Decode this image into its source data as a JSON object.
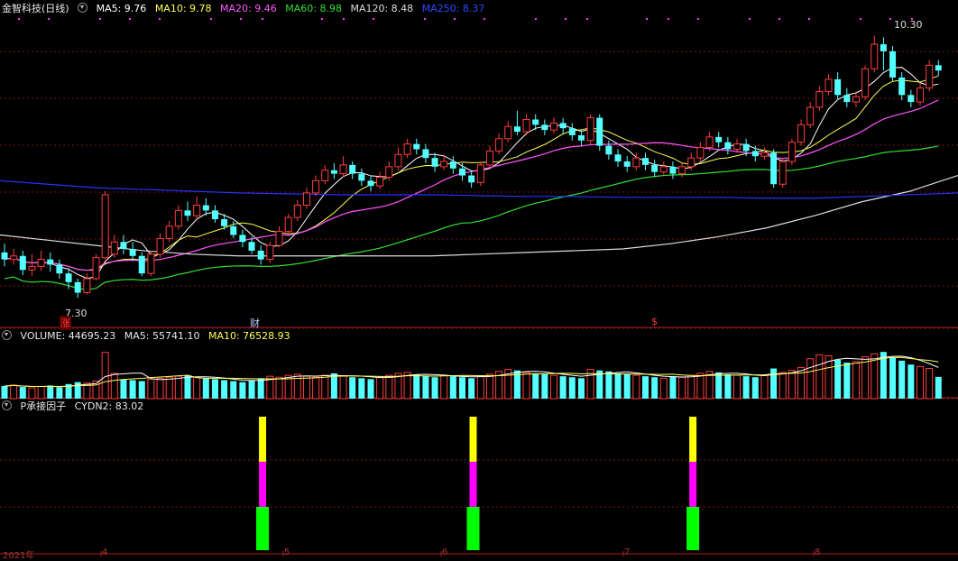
{
  "header_main": {
    "title": "金智科技(日线)",
    "ma5": "MA5: 9.76",
    "ma10": "MA10: 9.78",
    "ma20": "MA20: 9.46",
    "ma60": "MA60: 8.98",
    "ma120": "MA120: 8.48",
    "ma250": "MA250: 8.37"
  },
  "header_volume": {
    "volume": "VOLUME: 44695.23",
    "ma5": "MA5: 55741.10",
    "ma10": "MA10: 76528.93"
  },
  "header_indicator": {
    "name": "P承接因子",
    "value": "CYDN2: 83.02"
  },
  "annotations": {
    "high": "10.30",
    "low": "7.30",
    "tag_zhang": "涨",
    "tag_cai": "财",
    "tag_dollar": "$"
  },
  "bottom_axis": {
    "year": "2021年",
    "marks": [
      "4",
      "5",
      "6",
      "7",
      "8"
    ]
  },
  "colors": {
    "up": "#ff3c3c",
    "down": "#54ffff",
    "ma5": "#ffffff",
    "ma10": "#ffff55",
    "ma20": "#ff55ff",
    "ma60": "#33dd33",
    "ma120": "#dddddd",
    "ma250": "#2233ff",
    "grid": "#7a1515",
    "cyd_low": "#00ff00",
    "cyd_mid": "#ff00ff",
    "cyd_high": "#ffff00"
  },
  "chart_data": {
    "type": "candlestick",
    "price_range": [
      7.2,
      10.5
    ],
    "candles": [
      [
        7.82,
        7.74,
        7.92,
        7.66
      ],
      [
        7.74,
        7.78,
        7.86,
        7.68
      ],
      [
        7.78,
        7.62,
        7.84,
        7.56
      ],
      [
        7.62,
        7.66,
        7.8,
        7.55
      ],
      [
        7.66,
        7.74,
        7.84,
        7.61
      ],
      [
        7.74,
        7.68,
        7.82,
        7.6
      ],
      [
        7.68,
        7.58,
        7.74,
        7.52
      ],
      [
        7.58,
        7.48,
        7.64,
        7.4
      ],
      [
        7.48,
        7.36,
        7.52,
        7.3
      ],
      [
        7.36,
        7.52,
        7.58,
        7.34
      ],
      [
        7.52,
        7.76,
        7.8,
        7.5
      ],
      [
        7.76,
        8.48,
        8.52,
        7.74
      ],
      [
        7.8,
        7.94,
        8.02,
        7.76
      ],
      [
        7.94,
        7.86,
        8.02,
        7.8
      ],
      [
        7.86,
        7.78,
        7.94,
        7.72
      ],
      [
        7.78,
        7.58,
        7.82,
        7.55
      ],
      [
        7.58,
        7.8,
        7.84,
        7.55
      ],
      [
        7.8,
        7.98,
        8.04,
        7.76
      ],
      [
        7.98,
        8.12,
        8.18,
        7.94
      ],
      [
        8.12,
        8.3,
        8.36,
        8.08
      ],
      [
        8.3,
        8.24,
        8.4,
        8.18
      ],
      [
        8.24,
        8.36,
        8.46,
        8.2
      ],
      [
        8.36,
        8.3,
        8.44,
        8.24
      ],
      [
        8.3,
        8.2,
        8.36,
        8.16
      ],
      [
        8.2,
        8.12,
        8.26,
        8.08
      ],
      [
        8.12,
        8.02,
        8.18,
        7.98
      ],
      [
        8.02,
        7.94,
        8.08,
        7.88
      ],
      [
        7.94,
        7.84,
        8.0,
        7.8
      ],
      [
        7.84,
        7.74,
        7.9,
        7.68
      ],
      [
        7.74,
        7.9,
        7.94,
        7.7
      ],
      [
        7.9,
        8.06,
        8.12,
        7.88
      ],
      [
        8.06,
        8.22,
        8.26,
        8.02
      ],
      [
        8.22,
        8.36,
        8.42,
        8.18
      ],
      [
        8.36,
        8.5,
        8.56,
        8.32
      ],
      [
        8.5,
        8.64,
        8.7,
        8.46
      ],
      [
        8.64,
        8.76,
        8.82,
        8.6
      ],
      [
        8.76,
        8.72,
        8.84,
        8.66
      ],
      [
        8.72,
        8.82,
        8.92,
        8.68
      ],
      [
        8.82,
        8.72,
        8.86,
        8.66
      ],
      [
        8.72,
        8.64,
        8.78,
        8.58
      ],
      [
        8.64,
        8.58,
        8.7,
        8.52
      ],
      [
        8.58,
        8.68,
        8.74,
        8.54
      ],
      [
        8.68,
        8.8,
        8.86,
        8.64
      ],
      [
        8.8,
        8.94,
        9.02,
        8.76
      ],
      [
        8.94,
        9.06,
        9.12,
        8.9
      ],
      [
        9.06,
        9.0,
        9.12,
        8.94
      ],
      [
        9.0,
        8.9,
        9.06,
        8.84
      ],
      [
        8.9,
        8.8,
        8.96,
        8.74
      ],
      [
        8.8,
        8.86,
        8.94,
        8.76
      ],
      [
        8.86,
        8.78,
        8.92,
        8.72
      ],
      [
        8.78,
        8.7,
        8.84,
        8.64
      ],
      [
        8.7,
        8.62,
        8.76,
        8.56
      ],
      [
        8.62,
        8.82,
        8.86,
        8.58
      ],
      [
        8.82,
        8.98,
        9.04,
        8.78
      ],
      [
        8.98,
        9.12,
        9.18,
        8.94
      ],
      [
        9.12,
        9.26,
        9.32,
        9.08
      ],
      [
        9.26,
        9.2,
        9.44,
        9.16
      ],
      [
        9.2,
        9.34,
        9.4,
        9.16
      ],
      [
        9.34,
        9.28,
        9.4,
        9.22
      ],
      [
        9.28,
        9.22,
        9.34,
        9.16
      ],
      [
        9.22,
        9.3,
        9.36,
        9.18
      ],
      [
        9.3,
        9.24,
        9.36,
        9.18
      ],
      [
        9.24,
        9.16,
        9.3,
        9.1
      ],
      [
        9.16,
        9.1,
        9.22,
        9.04
      ],
      [
        9.1,
        9.36,
        9.4,
        9.06
      ],
      [
        9.36,
        9.04,
        9.4,
        8.98
      ],
      [
        9.04,
        8.94,
        9.1,
        8.88
      ],
      [
        8.94,
        8.86,
        9.0,
        8.8
      ],
      [
        8.86,
        8.8,
        8.92,
        8.74
      ],
      [
        8.8,
        8.9,
        8.96,
        8.76
      ],
      [
        8.9,
        8.82,
        8.96,
        8.76
      ],
      [
        8.82,
        8.74,
        8.88,
        8.68
      ],
      [
        8.74,
        8.8,
        8.86,
        8.7
      ],
      [
        8.8,
        8.72,
        8.86,
        8.66
      ],
      [
        8.72,
        8.8,
        8.84,
        8.68
      ],
      [
        8.8,
        8.9,
        8.96,
        8.76
      ],
      [
        8.9,
        9.02,
        9.08,
        8.86
      ],
      [
        9.02,
        9.14,
        9.2,
        8.98
      ],
      [
        9.14,
        9.08,
        9.2,
        9.02
      ],
      [
        9.08,
        9.0,
        9.14,
        8.94
      ],
      [
        9.0,
        9.06,
        9.12,
        8.96
      ],
      [
        9.06,
        8.98,
        9.12,
        8.92
      ],
      [
        8.98,
        8.92,
        9.04,
        8.86
      ],
      [
        8.92,
        8.96,
        9.02,
        8.88
      ],
      [
        8.96,
        8.6,
        9.0,
        8.56
      ],
      [
        8.6,
        8.86,
        8.9,
        8.56
      ],
      [
        8.86,
        9.08,
        9.12,
        8.82
      ],
      [
        9.08,
        9.28,
        9.34,
        9.04
      ],
      [
        9.28,
        9.48,
        9.54,
        9.24
      ],
      [
        9.48,
        9.66,
        9.72,
        9.44
      ],
      [
        9.66,
        9.8,
        9.86,
        9.62
      ],
      [
        9.8,
        9.62,
        9.88,
        9.56
      ],
      [
        9.62,
        9.54,
        9.7,
        9.48
      ],
      [
        9.54,
        9.6,
        9.66,
        9.48
      ],
      [
        9.6,
        9.92,
        9.96,
        9.56
      ],
      [
        9.92,
        10.2,
        10.3,
        9.88
      ],
      [
        10.2,
        10.12,
        10.28,
        9.9
      ],
      [
        10.12,
        9.82,
        10.18,
        9.78
      ],
      [
        9.82,
        9.62,
        9.88,
        9.56
      ],
      [
        9.62,
        9.54,
        9.68,
        9.48
      ],
      [
        9.54,
        9.7,
        9.76,
        9.5
      ],
      [
        9.7,
        9.96,
        10.02,
        9.66
      ],
      [
        9.96,
        9.9,
        10.02,
        9.84
      ]
    ],
    "volume": [
      26000,
      28000,
      24000,
      22000,
      25000,
      27000,
      23000,
      30000,
      34000,
      32000,
      36000,
      95000,
      52000,
      40000,
      38000,
      36000,
      40000,
      42000,
      44000,
      46000,
      48000,
      44000,
      42000,
      40000,
      38000,
      36000,
      34000,
      38000,
      42000,
      46000,
      44000,
      48000,
      50000,
      46000,
      44000,
      48000,
      52000,
      46000,
      44000,
      42000,
      40000,
      44000,
      48000,
      52000,
      54000,
      50000,
      46000,
      44000,
      48000,
      46000,
      44000,
      42000,
      46000,
      50000,
      56000,
      60000,
      58000,
      54000,
      52000,
      50000,
      48000,
      46000,
      44000,
      42000,
      60000,
      58000,
      56000,
      52000,
      50000,
      48000,
      46000,
      44000,
      42000,
      46000,
      44000,
      48000,
      52000,
      56000,
      54000,
      50000,
      48000,
      46000,
      44000,
      48000,
      62000,
      54000,
      58000,
      64000,
      82000,
      90000,
      88000,
      80000,
      74000,
      76000,
      86000,
      92000,
      96000,
      84000,
      78000,
      70000,
      66000,
      62000,
      44695
    ],
    "cyd_bars": [
      {
        "index": 27,
        "values": [
          60,
          40,
          50
        ]
      },
      {
        "index": 50,
        "values": [
          60,
          40,
          50
        ]
      },
      {
        "index": 74,
        "values": [
          60,
          40,
          50
        ]
      }
    ]
  }
}
